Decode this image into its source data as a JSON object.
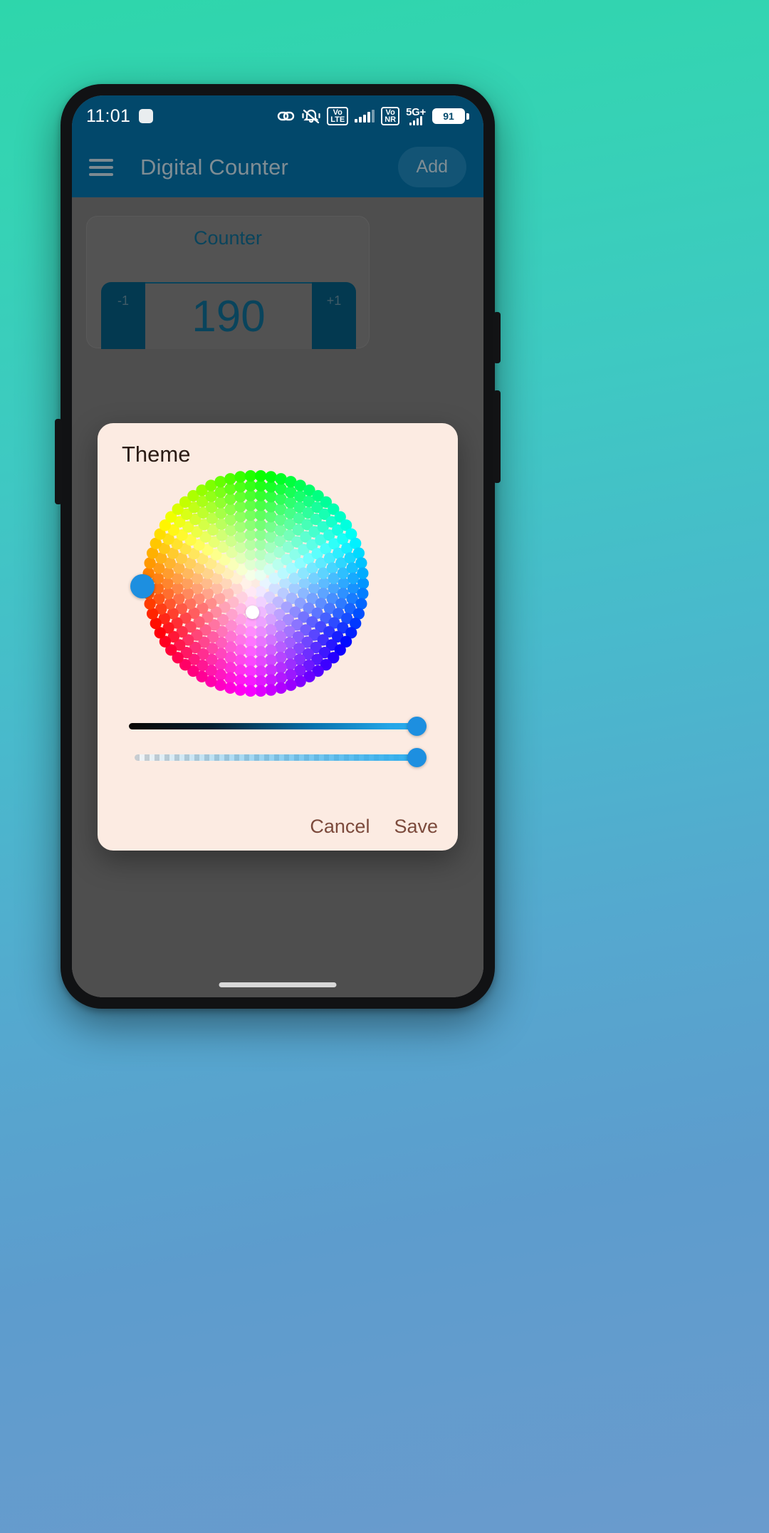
{
  "status_bar": {
    "time": "11:01",
    "icons": [
      {
        "name": "link-icon",
        "glyph": "⚭"
      },
      {
        "name": "bell-muted-icon",
        "glyph": "🔕"
      },
      {
        "name": "volte-icon",
        "label_top": "Vo",
        "label_bottom": "LTE"
      },
      {
        "name": "signal-bars-icon",
        "label": ""
      },
      {
        "name": "vonr-icon",
        "label_top": "Vo",
        "label_bottom": "NR"
      },
      {
        "name": "network-5g-icon",
        "label": "5G+"
      }
    ],
    "battery_level": "91"
  },
  "app_bar": {
    "menu_icon": "hamburger-menu-icon",
    "title": "Digital Counter",
    "add_label": "Add"
  },
  "counter_card": {
    "title": "Counter",
    "decrement_label": "-1",
    "value": "190",
    "increment_label": "+1"
  },
  "theme_dialog": {
    "title": "Theme",
    "cancel_label": "Cancel",
    "save_label": "Save",
    "selected_color": "#1d8fe0",
    "dialog_background": "#fcebe2",
    "action_text_color": "#7c4a3c",
    "brightness_slider": {
      "value_percent": 100
    },
    "alpha_slider": {
      "value_percent": 100
    }
  },
  "theme_colors": {
    "app_bar": "#02486b",
    "accent": "#0d5f80",
    "wallpaper_top": "#2ed6ab",
    "wallpaper_bottom": "#6a9bcd"
  }
}
